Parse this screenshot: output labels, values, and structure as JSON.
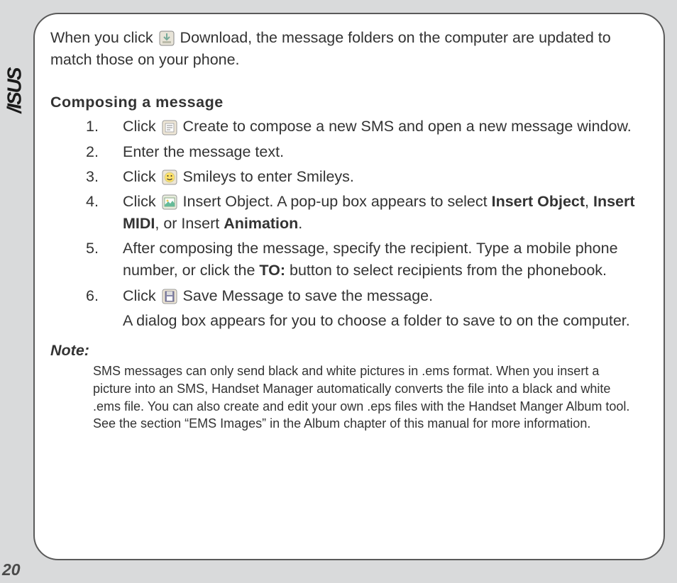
{
  "brand": "/ISUS",
  "page_number": "20",
  "intro": {
    "pre": "When you click ",
    "post": " Download, the message folders on the computer are updated to match those on your phone."
  },
  "section_heading": "Composing  a  message",
  "steps": {
    "s1": {
      "num": "1.",
      "pre": "Click ",
      "post": " Create to compose a new SMS and open a new message window."
    },
    "s2": {
      "num": "2.",
      "text": "Enter the message text."
    },
    "s3": {
      "num": "3.",
      "pre": "Click ",
      "post": " Smileys to enter Smileys."
    },
    "s4": {
      "num": "4.",
      "pre": "Click ",
      "post_a": "  Insert Object. A pop-up box appears to select ",
      "b1": "Insert Object",
      "sep1": ", ",
      "b2": "Insert MIDI",
      "sep2": ", or Insert ",
      "b3": "Animation",
      "end": "."
    },
    "s5": {
      "num": "5.",
      "a": "After composing the message, specify the recipient. Type a mobile phone number, or click the ",
      "b": "TO:",
      "c": " button to select recipients from the phonebook."
    },
    "s6": {
      "num": "6.",
      "pre": "Click ",
      "post": " Save Message to save the message."
    },
    "s6_extra": "A dialog box appears for you to choose a folder to save to on the computer."
  },
  "note": {
    "label": "Note:",
    "text": "SMS messages can only send black and white pictures in .ems format. When you insert a picture into an SMS, Handset Manager automatically converts the file into a black and white .ems file. You can also create and edit your own .eps files with the Handset Manger Album tool. See the section “EMS Images” in the Album chapter of this manual for more information."
  },
  "icons": {
    "download": "download-icon",
    "create": "create-icon",
    "smileys": "smileys-icon",
    "insert_object": "insert-object-icon",
    "save": "save-icon"
  }
}
